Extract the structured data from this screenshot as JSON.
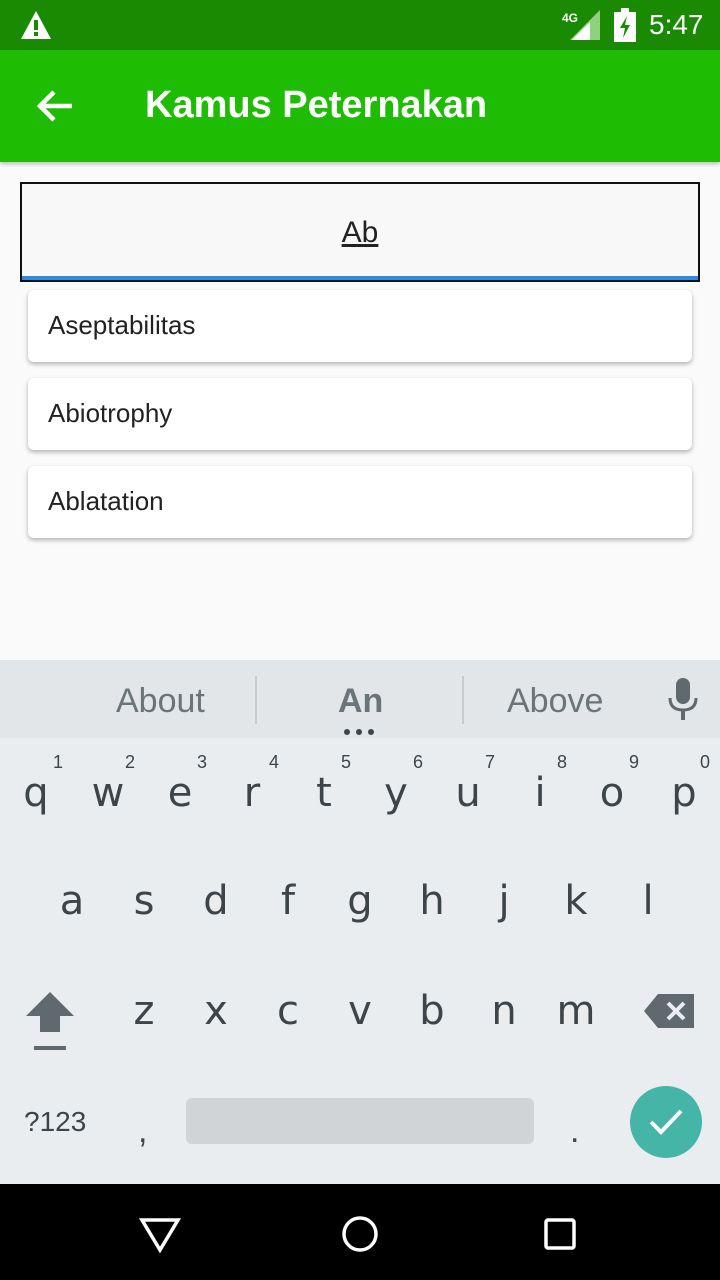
{
  "status": {
    "network": "4G",
    "time": "5:47"
  },
  "appbar": {
    "title": "Kamus Peternakan"
  },
  "search": {
    "value": "Ab"
  },
  "suggestions": [
    "Aseptabilitas",
    "Abiotrophy",
    "Ablatation"
  ],
  "keyboard": {
    "word_suggestions": [
      "About",
      "An",
      "Above"
    ],
    "row1": [
      "q",
      "w",
      "e",
      "r",
      "t",
      "y",
      "u",
      "i",
      "o",
      "p"
    ],
    "row1_hints": [
      "1",
      "2",
      "3",
      "4",
      "5",
      "6",
      "7",
      "8",
      "9",
      "0"
    ],
    "row2": [
      "a",
      "s",
      "d",
      "f",
      "g",
      "h",
      "j",
      "k",
      "l"
    ],
    "row3": [
      "z",
      "x",
      "c",
      "v",
      "b",
      "n",
      "m"
    ],
    "symbols_label": "?123",
    "comma": ",",
    "period": "."
  },
  "colors": {
    "statusbar": "#1a8a02",
    "appbar": "#1ebd04",
    "accent": "#2f8be0",
    "enter": "#45b5a8"
  }
}
